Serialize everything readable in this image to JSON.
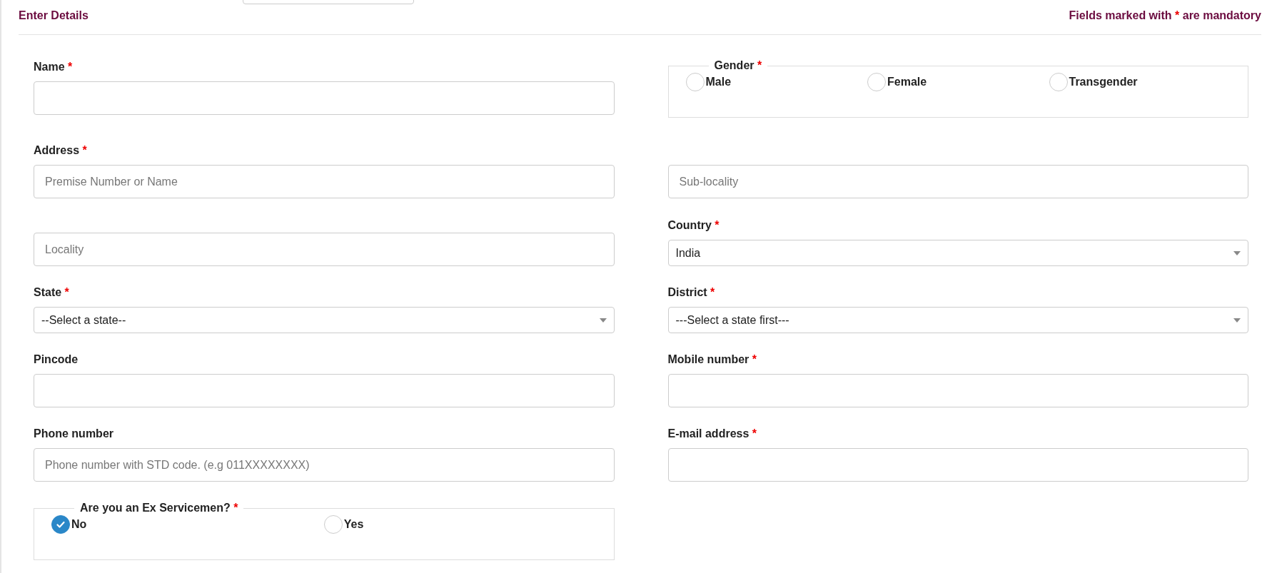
{
  "header": {
    "title": "Enter Details",
    "note_before": "Fields marked with",
    "note_mark": "*",
    "note_after": "are mandatory"
  },
  "rows": [
    {
      "left": {
        "kind": "input",
        "label": "Name",
        "required_mark": "*"
      },
      "right": {
        "kind": "radio-group",
        "label": "Gender",
        "required_mark": "*",
        "options": [
          {
            "label": "Male",
            "selected": false
          },
          {
            "label": "Female",
            "selected": false
          },
          {
            "label": "Transgender",
            "selected": false
          }
        ]
      }
    },
    {
      "left": {
        "kind": "input",
        "label": "Address",
        "required_mark": "*",
        "placeholder": "Premise Number or Name"
      },
      "right": {
        "kind": "input",
        "placeholder": "Sub-locality"
      }
    },
    {
      "left": {
        "kind": "input",
        "placeholder": "Locality"
      },
      "right": {
        "kind": "select",
        "label": "Country",
        "required_mark": "*",
        "value": "India"
      }
    },
    {
      "left": {
        "kind": "select",
        "label": "State",
        "required_mark": "*",
        "value": "--Select a state--"
      },
      "right": {
        "kind": "select",
        "label": "District",
        "required_mark": "*",
        "value": "---Select a state first---"
      }
    },
    {
      "left": {
        "kind": "input",
        "label": "Pincode"
      },
      "right": {
        "kind": "input",
        "label": "Mobile number",
        "required_mark": "*"
      }
    },
    {
      "left": {
        "kind": "input",
        "label": "Phone number",
        "placeholder": "Phone number with STD code. (e.g 011XXXXXXXX)"
      },
      "right": {
        "kind": "input",
        "label": "E-mail address",
        "required_mark": "*"
      }
    },
    {
      "left": {
        "kind": "radio-group",
        "label": "Are you an Ex Servicemen?",
        "required_mark": "*",
        "options": [
          {
            "label": "No",
            "selected": true
          },
          {
            "label": "Yes",
            "selected": false
          }
        ]
      }
    }
  ]
}
